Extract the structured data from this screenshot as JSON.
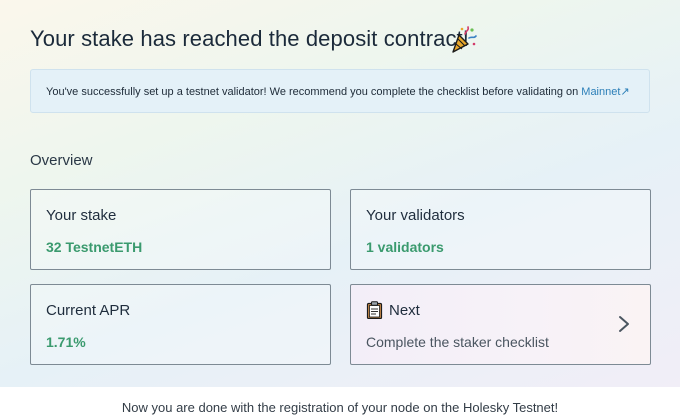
{
  "title": "Your stake has reached the deposit contract!",
  "title_icon": "party-popper-icon",
  "alert": {
    "text": "You've successfully set up a testnet validator! We recommend you complete the checklist before validating on ",
    "link": "Mainnet",
    "link_icon": "external-link-icon"
  },
  "overview": {
    "heading": "Overview",
    "cards": [
      {
        "label": "Your stake",
        "value": "32 TestnetETH"
      },
      {
        "label": "Your validators",
        "value": "1 validators"
      },
      {
        "label": "Current APR",
        "value": "1.71%"
      }
    ],
    "next": {
      "icon": "clipboard-icon",
      "label": "Next",
      "sub": "Complete the staker checklist",
      "arrow_icon": "chevron-right-icon"
    }
  },
  "footer": "Now you are done with the registration of your node on the Holesky Testnet!",
  "colors": {
    "value_green": "#3a9a6e",
    "link_blue": "#2c7fb8",
    "alert_bg": "#e4f1f8"
  }
}
